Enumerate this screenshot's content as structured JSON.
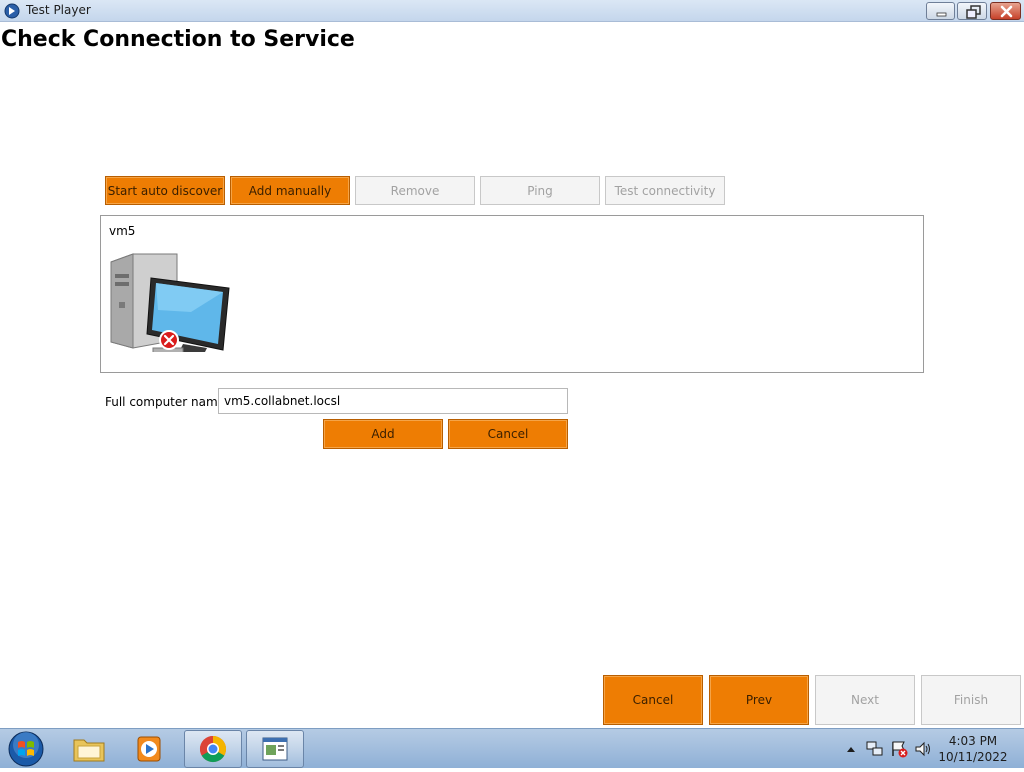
{
  "window": {
    "title": "Test Player"
  },
  "page": {
    "title": "Check Connection to Service"
  },
  "toolbar": {
    "start_auto_discover": "Start auto discover",
    "add_manually": "Add manually",
    "remove": "Remove",
    "ping": "Ping",
    "test_connectivity": "Test connectivity"
  },
  "hosts": [
    {
      "name": "vm5",
      "icon": "computer-error-icon"
    }
  ],
  "form": {
    "full_computer_name_label": "Full computer name:",
    "full_computer_name_value": "vm5.collabnet.locsl",
    "add_label": "Add",
    "cancel_label": "Cancel"
  },
  "footer": {
    "cancel": "Cancel",
    "prev": "Prev",
    "next": "Next",
    "finish": "Finish"
  },
  "taskbar": {
    "items": [
      "start-orb-icon",
      "folder-icon",
      "media-player-icon",
      "chrome-icon",
      "test-player-app-icon"
    ],
    "clock_time": "4:03 PM",
    "clock_date": "10/11/2022"
  },
  "colors": {
    "accent_orange": "#ee7d03",
    "disabled_gray": "#f4f4f4"
  }
}
